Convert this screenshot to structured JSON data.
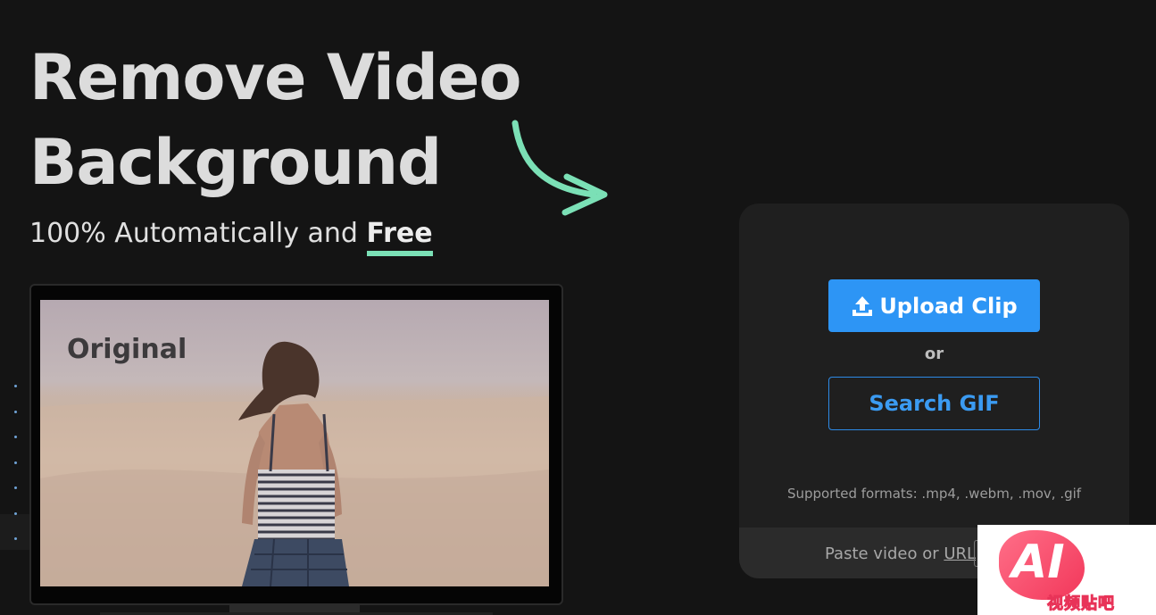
{
  "hero": {
    "title_line1": "Remove Video",
    "title_line2": "Background",
    "subtitle_prefix": "100% Automatically and",
    "subtitle_emphasis": "Free"
  },
  "preview": {
    "label": "Original"
  },
  "upload": {
    "upload_button_label": "Upload Clip",
    "or_text": "or",
    "search_button_label": "Search GIF",
    "supported_formats": "Supported formats: .mp4, .webm, .mov, .gif",
    "paste_prefix": "Paste video or",
    "paste_link": "URL"
  },
  "watermark": {
    "logo_text": "AI",
    "logo_subtext": "视频贴吧"
  },
  "colors": {
    "background": "#141414",
    "accent_blue": "#2d95f5",
    "accent_green": "#7be0b6",
    "card": "#1f1f1f"
  },
  "icons": [
    "upload-icon",
    "curved-arrow-icon"
  ]
}
